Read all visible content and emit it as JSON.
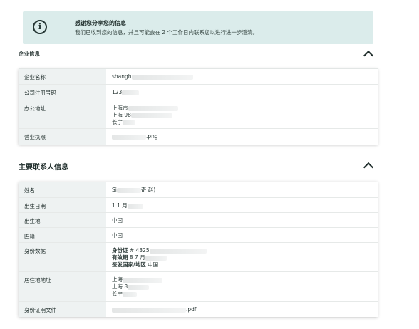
{
  "notice": {
    "icon": "info-icon",
    "title": "感谢您分享您的信息",
    "body": "我们已收到您的信息，并且可能会在 2 个工作日内联系您以进行进一步澄清。"
  },
  "company_section": {
    "title": "企业信息",
    "toggle_icon": "chevron-up-icon",
    "rows": [
      {
        "label": "企业名称",
        "lines": [
          {
            "text": "shangh"
          }
        ]
      },
      {
        "label": "公司注册号码",
        "lines": [
          {
            "text": "123"
          }
        ]
      },
      {
        "label": "办公地址",
        "lines": [
          {
            "text": "上海市"
          },
          {
            "text": "上海 98"
          },
          {
            "text": "长宁"
          }
        ]
      },
      {
        "label": "营业执照",
        "lines": [
          {
            "text": ".png"
          }
        ]
      }
    ]
  },
  "contact_section": {
    "title": "主要联系人信息",
    "toggle_icon": "chevron-up-icon",
    "rows": [
      {
        "label": "姓名",
        "lines": [
          {
            "text": "Si"
          },
          {
            "text": "奇 赵)"
          }
        ]
      },
      {
        "label": "出生日期",
        "lines": [
          {
            "text": "1 1 月"
          }
        ]
      },
      {
        "label": "出生地",
        "lines": [
          {
            "text": "中国"
          }
        ]
      },
      {
        "label": "国籍",
        "lines": [
          {
            "text": "中国"
          }
        ]
      },
      {
        "label": "身份数据",
        "lines": [
          {
            "key": "身份证",
            "text": "# 4325"
          },
          {
            "key": "有效期",
            "text": "8 7 月"
          },
          {
            "key": "签发国家/地区",
            "text": "中国"
          }
        ]
      },
      {
        "label": "居住地地址",
        "lines": [
          {
            "text": "上海"
          },
          {
            "text": "上海 8"
          },
          {
            "text": "长宁"
          }
        ]
      },
      {
        "label": "身份证明文件",
        "lines": [
          {
            "text": ".pdf"
          }
        ]
      }
    ]
  }
}
